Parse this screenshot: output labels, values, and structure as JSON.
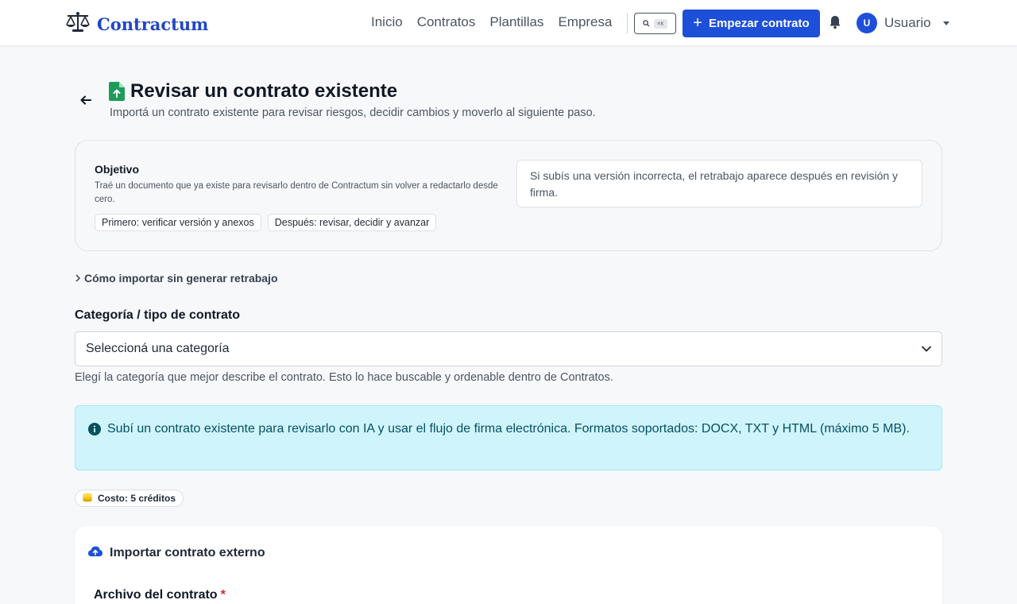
{
  "brand": {
    "name": "Contractum"
  },
  "nav": {
    "links": [
      "Inicio",
      "Contratos",
      "Plantillas",
      "Empresa"
    ],
    "search_shortcut": "⌘K",
    "cta_label": "Empezar contrato",
    "user_initial": "U",
    "user_name": "Usuario"
  },
  "header": {
    "title": "Revisar un contrato existente",
    "subtitle": "Importá un contrato existente para revisar riesgos, decidir cambios y moverlo al siguiente paso."
  },
  "objective": {
    "title": "Objetivo",
    "description": "Traé un documento que ya existe para revisarlo dentro de Contractum sin volver a redactarlo desde cero.",
    "chips": [
      "Primero: verificar versión y anexos",
      "Después: revisar, decidir y avanzar"
    ],
    "note": "Si subís una versión incorrecta, el retrabajo aparece después en revisión y firma."
  },
  "collapse": {
    "label": "Cómo importar sin generar retrabajo"
  },
  "category": {
    "label": "Categoría / tipo de contrato",
    "selected": "Seleccioná una categoría",
    "help": "Elegí la categoría que mejor describe el contrato. Esto lo hace buscable y ordenable dentro de Contratos."
  },
  "alert": {
    "text": "Subí un contrato existente para revisarlo con IA y usar el flujo de firma electrónica. Formatos soportados: DOCX, TXT y HTML (máximo 5 MB)."
  },
  "cost": {
    "label": "Costo: 5 créditos"
  },
  "import": {
    "title": "Importar contrato externo",
    "file_label": "Archivo del contrato",
    "required_mark": "*"
  },
  "colors": {
    "accent": "#1d4fd8",
    "alert_bg": "#cff4fc",
    "alert_text": "#055160",
    "file_icon": "#1e9b5b",
    "required": "#dc2626"
  },
  "icons": {
    "brand": "scales-icon",
    "search": "search-icon",
    "plus": "plus-icon",
    "bell": "bell-icon",
    "back": "arrow-left-icon",
    "title": "file-upload-icon",
    "chevron": "chevron-right-icon",
    "select": "chevron-down-icon",
    "info": "info-circle-icon",
    "coins": "coins-icon",
    "cloud": "cloud-upload-icon"
  }
}
